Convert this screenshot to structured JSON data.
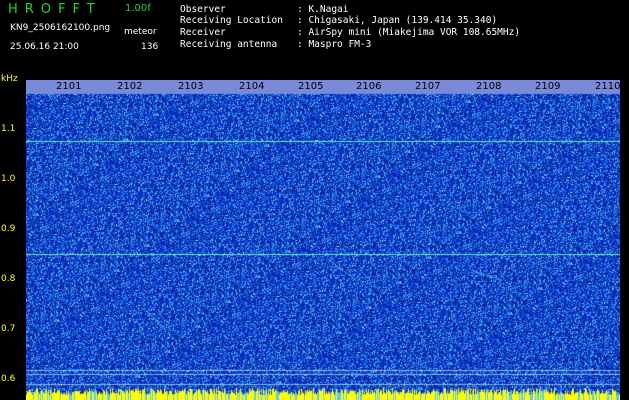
{
  "header": {
    "app_title": "HROFFT",
    "version": "1.00f",
    "filename": "KN9_2506162100.png",
    "source": "meteor",
    "datetime": "25.06.16 21:00",
    "count": "136"
  },
  "info": {
    "rows": [
      {
        "label": "Observer",
        "value": ": K.Nagai"
      },
      {
        "label": "Receiving Location",
        "value": ": Chigasaki, Japan (139.414 35.340)"
      },
      {
        "label": "Receiver",
        "value": ": AirSpy mini (Miakejima VOR 108.65MHz)"
      },
      {
        "label": "Receiving antenna",
        "value": ": Maspro FM-3"
      }
    ]
  },
  "spectrogram": {
    "y_unit": "kHz",
    "y_ticks": [
      "1.1",
      "1.0",
      "0.9",
      "0.8",
      "0.7",
      "0.6"
    ],
    "x_ticks": [
      "2101",
      "2102",
      "2103",
      "2104",
      "2105",
      "2106",
      "2107",
      "2108",
      "2109",
      "2110"
    ],
    "y_range_khz": [
      0.58,
      1.2
    ],
    "carrier_lines_khz": [
      1.1,
      0.86
    ],
    "colors": {
      "background": "#1a2fb0",
      "noise_high": "#5cc8ff",
      "carrier": "#60f0c0",
      "tick_text": "#ffff00",
      "header_green": "#1ed43a",
      "bottom_band": "#ffff00"
    }
  }
}
